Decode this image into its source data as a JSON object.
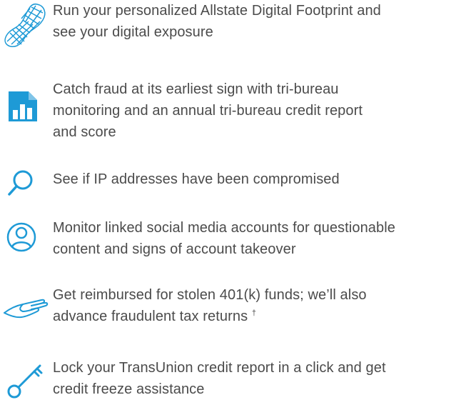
{
  "theme": {
    "accent_color": "#1e9ad6",
    "text_color": "#4b4b4b"
  },
  "features": [
    {
      "icon": "footprint-icon",
      "lines": [
        "Run your personalized Allstate Digital Footprint and",
        "see your digital exposure"
      ]
    },
    {
      "icon": "report-chart-icon",
      "lines": [
        "Catch fraud at its earliest sign with tri-bureau",
        "monitoring and an annual tri-bureau credit report",
        "and score"
      ]
    },
    {
      "icon": "search-icon",
      "lines": [
        "See if IP addresses have been compromised"
      ]
    },
    {
      "icon": "user-profile-icon",
      "lines": [
        "Monitor linked social media accounts for questionable",
        "content and signs of account takeover"
      ]
    },
    {
      "icon": "open-hand-icon",
      "lines": [
        "Get reimbursed for stolen 401(k) funds; we’ll also",
        "advance fraudulent tax returns"
      ],
      "footnote_mark": "†"
    },
    {
      "icon": "key-icon",
      "lines": [
        "Lock your TransUnion credit report in a click and get",
        "credit freeze assistance"
      ]
    }
  ]
}
